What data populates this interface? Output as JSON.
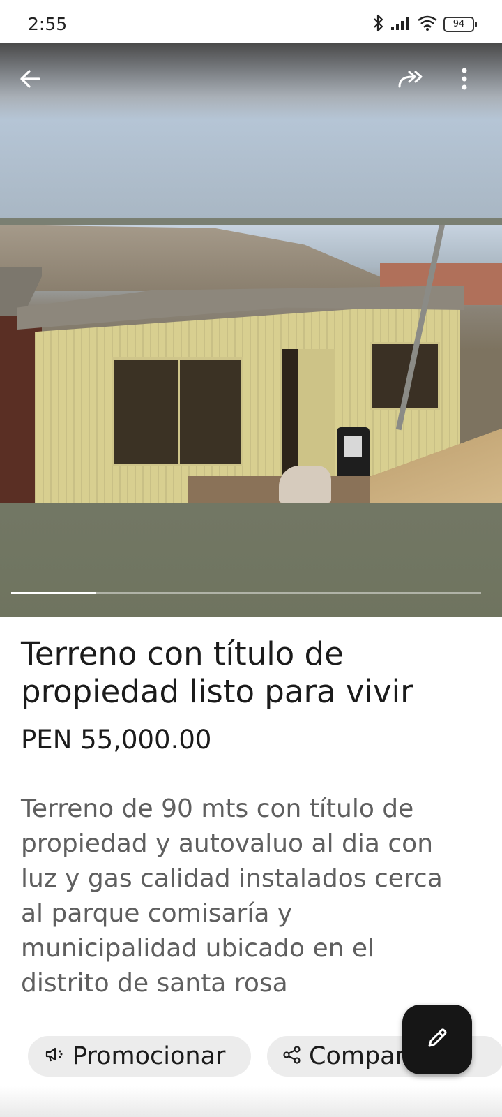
{
  "status_bar": {
    "time": "2:55",
    "battery": "94",
    "icons": [
      "bluetooth-icon",
      "signal-icon",
      "wifi-icon",
      "battery-icon"
    ]
  },
  "toolbar": {
    "icons": [
      "back-arrow-icon",
      "share-forward-icon",
      "more-vert-icon"
    ]
  },
  "gallery": {
    "photo_count_progress": 0.18,
    "icon_color": "#ffffff"
  },
  "listing": {
    "title": "Terreno con título de propiedad listo para vivir",
    "price": "PEN 55,000.00",
    "description": "Terreno de 90 mts con título de propiedad y autovaluo al dia con luz y gas calidad instalados cerca al parque comisaría y municipalidad ubicado en el distrito de santa rosa"
  },
  "actions": {
    "promote_label": "Promocionar",
    "share_label": "Compartir",
    "edit_icon": "pencil-icon"
  },
  "colors": {
    "fab_background": "#161616",
    "chip_background": "#ececec",
    "description_text": "#5f5f5f"
  }
}
